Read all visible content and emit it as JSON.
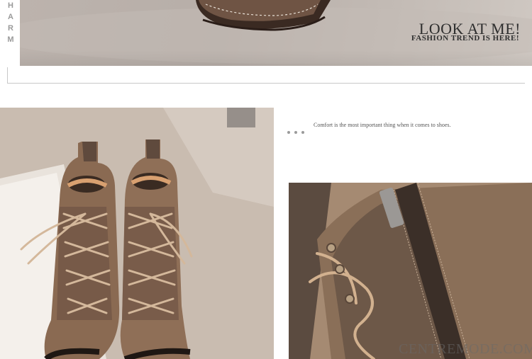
{
  "banner": {
    "side_text": "HARM",
    "title": "LOOK AT ME!",
    "subtitle": "FASHION TREND IS HERE!"
  },
  "caption": {
    "text": "Comfort is the most important thing when it comes to shoes."
  },
  "watermark": {
    "text": "CENTREMODE.COM"
  },
  "colors": {
    "leather": "#8a6a52",
    "leather_dark": "#5f4a3d",
    "lace": "#c9a98c",
    "floor": "#b8b0aa"
  }
}
